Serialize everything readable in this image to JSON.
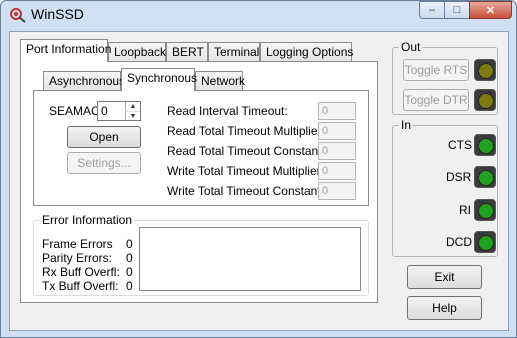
{
  "window": {
    "title": "WinSSD",
    "caption_min": "–",
    "caption_max": "□",
    "caption_close": "✕"
  },
  "tabs": [
    "Port Information",
    "Loopback",
    "BERT",
    "Terminal",
    "Logging Options"
  ],
  "subtabs": [
    "Asynchronous",
    "Synchronous",
    "Network"
  ],
  "sync": {
    "seamac_label": "SEAMAC",
    "seamac_value": "0",
    "open_button": "Open",
    "settings_button": "Settings...",
    "timeouts": [
      {
        "label": "Read Interval Timeout:",
        "value": "0"
      },
      {
        "label": "Read Total Timeout Multiplier:",
        "value": "0"
      },
      {
        "label": "Read Total Timeout Constant:",
        "value": "0"
      },
      {
        "label": "Write Total Timeout Multiplier:",
        "value": "0"
      },
      {
        "label": "Write Total Timeout Constant:",
        "value": "0"
      }
    ]
  },
  "errors": {
    "title": "Error Information",
    "items": [
      {
        "label": "Frame Errors",
        "value": "0"
      },
      {
        "label": "Parity Errors:",
        "value": "0"
      },
      {
        "label": "Rx Buff Overfl:",
        "value": "0"
      },
      {
        "label": "Tx Buff Overfl:",
        "value": "0"
      }
    ]
  },
  "out_group": {
    "title": "Out",
    "toggle_rts": "Toggle RTS",
    "toggle_dtr": "Toggle DTR"
  },
  "in_group": {
    "title": "In",
    "signals": [
      "CTS",
      "DSR",
      "RI",
      "DCD"
    ]
  },
  "buttons": {
    "exit": "Exit",
    "help": "Help"
  },
  "colors": {
    "led_off": "#7d7a10",
    "led_on": "#1fa31f"
  }
}
